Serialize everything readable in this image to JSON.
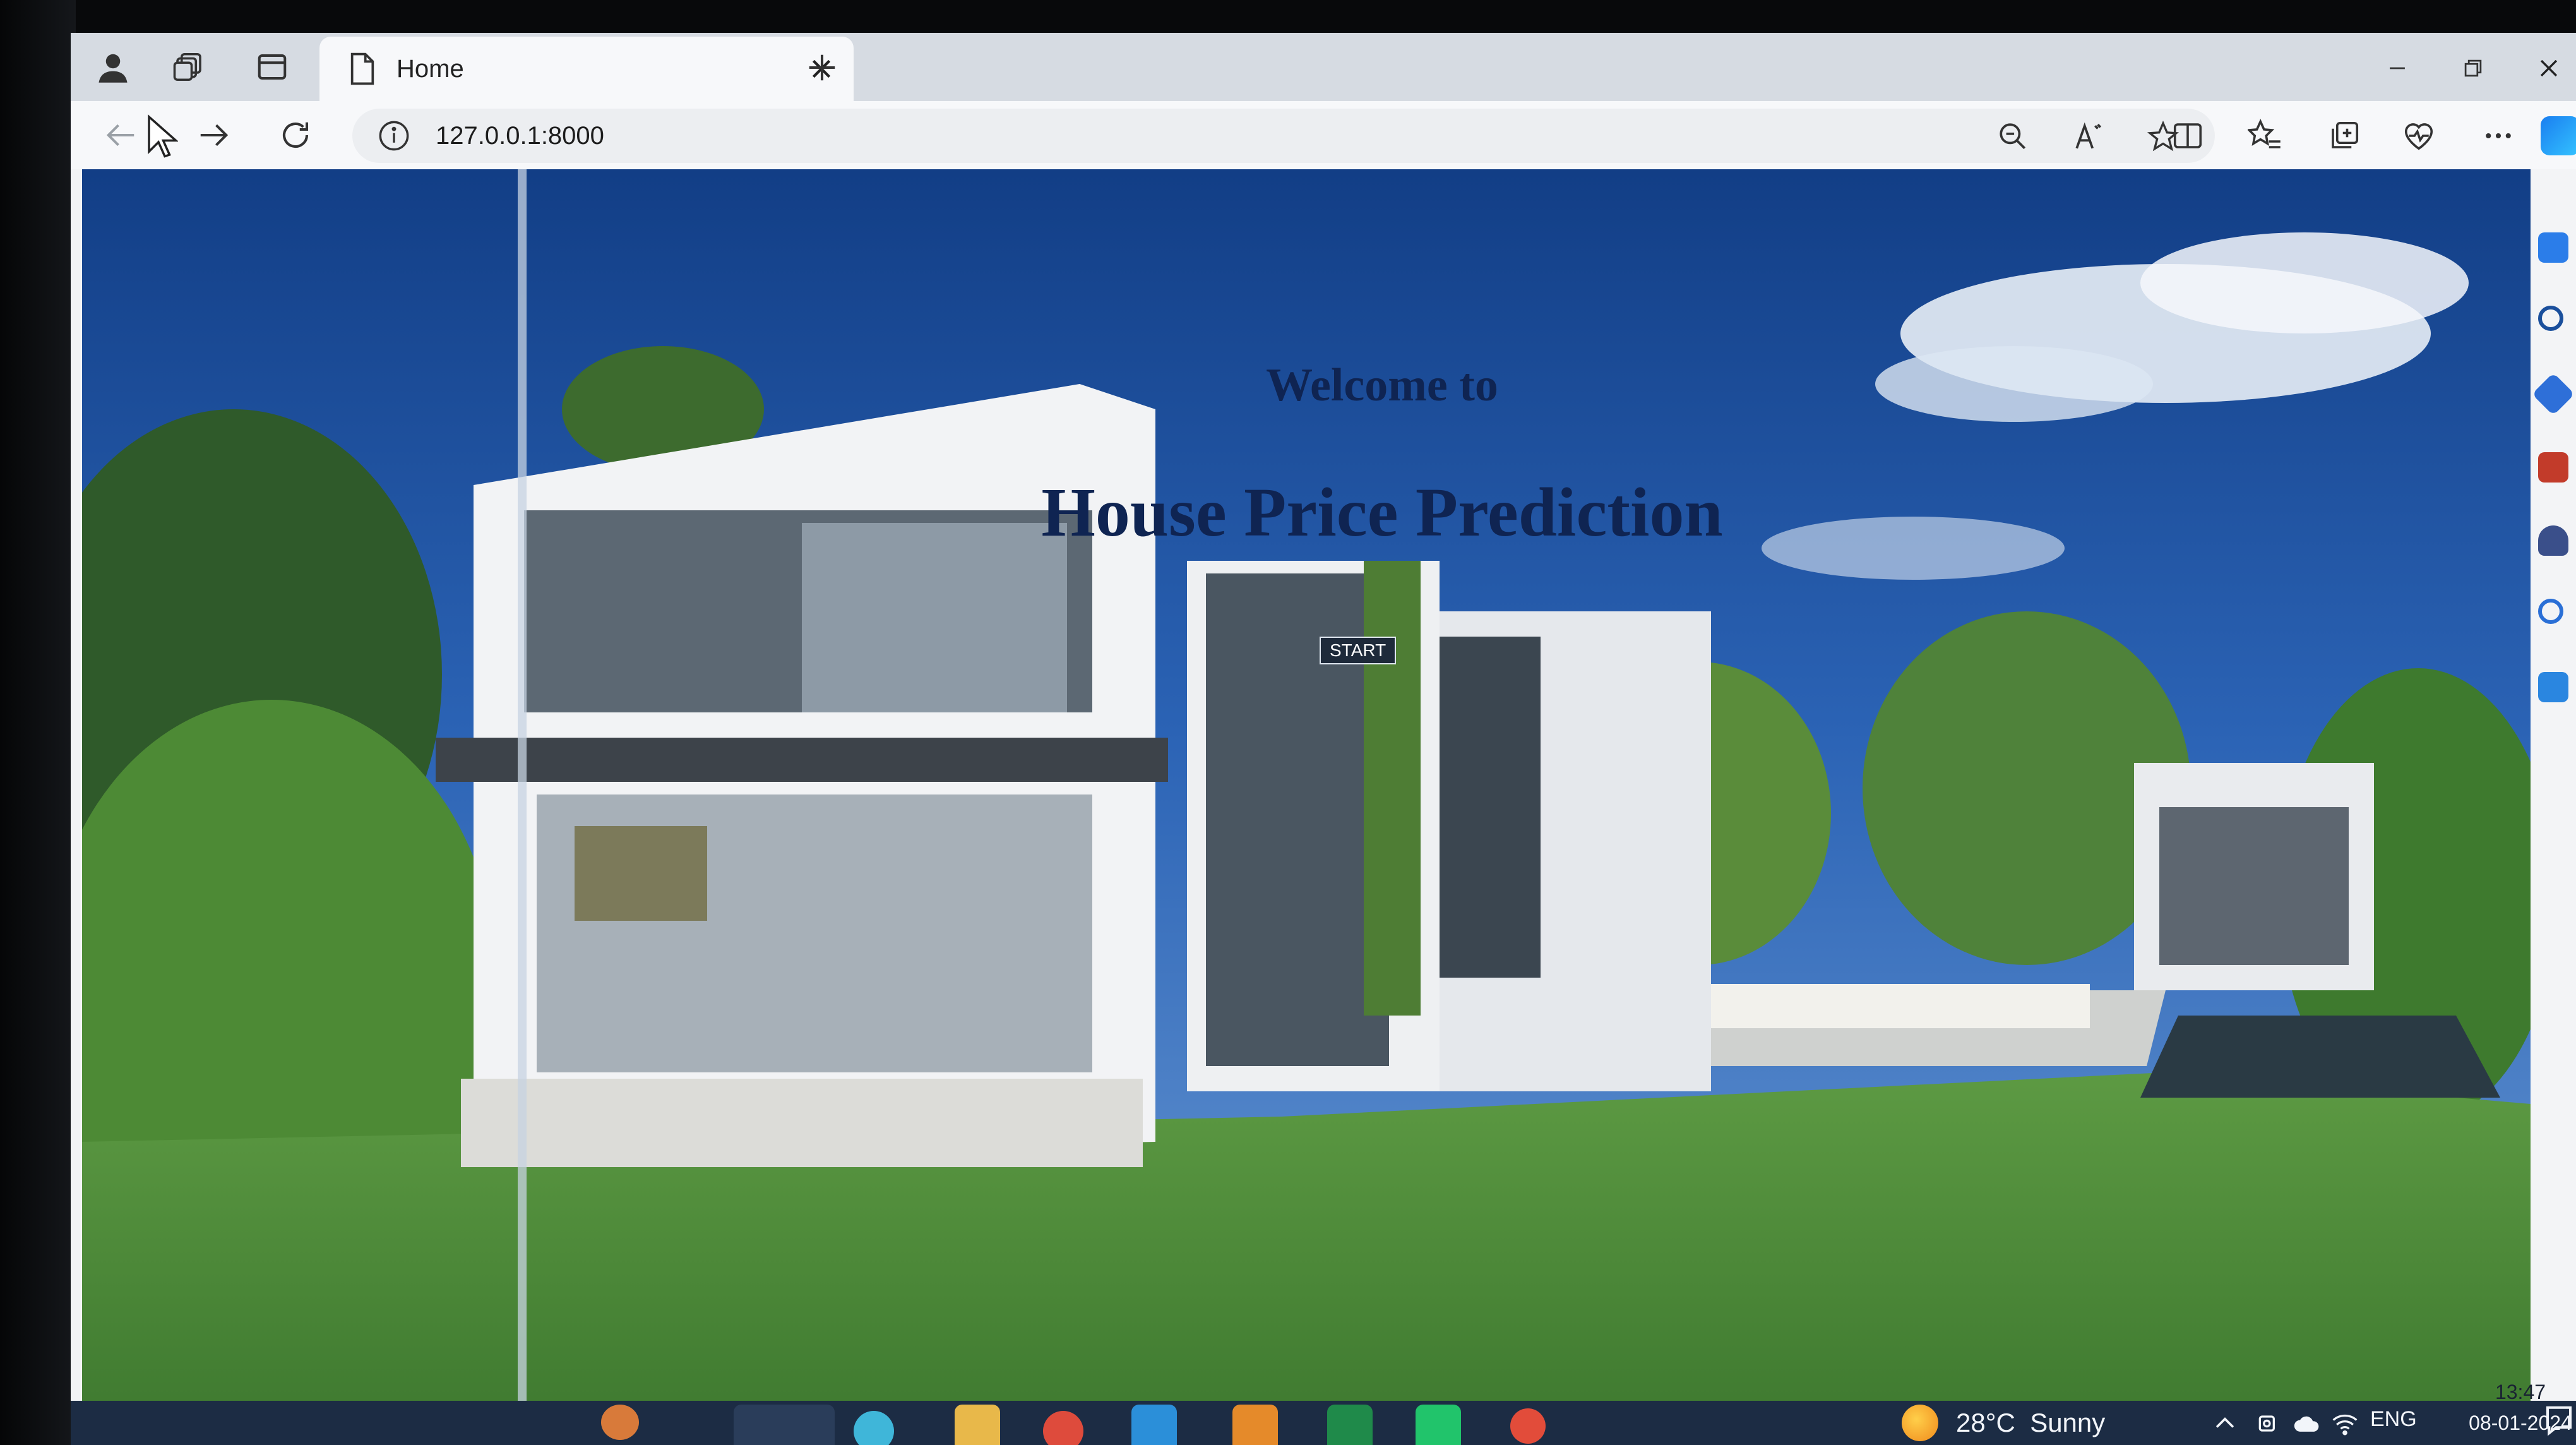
{
  "browser": {
    "tab": {
      "title": "Home"
    },
    "address_bar": {
      "url": "127.0.0.1:8000"
    }
  },
  "page": {
    "welcome_text": "Welcome to",
    "heading": "House Price Prediction",
    "start_button_label": "START"
  },
  "taskbar": {
    "weather": {
      "temperature": "28°C",
      "condition": "Sunny"
    },
    "language": "ENG",
    "clock": {
      "time": "13:47",
      "date": "08-01-2024"
    }
  },
  "colors": {
    "heading": "#0f2452",
    "sky": "#2b63b5",
    "lawn": "#4e8f3a",
    "taskbar": "#1c2c44",
    "tab_strip": "#d6dbe2"
  },
  "icons": [
    "profile-icon",
    "workspaces-icon",
    "tab-actions-icon",
    "page-icon",
    "close-icon",
    "plus-icon",
    "minimize-icon",
    "restore-icon",
    "close-window-icon",
    "back-arrow-icon",
    "forward-arrow-icon",
    "refresh-icon",
    "cursor-icon",
    "info-icon",
    "zoom-out-icon",
    "read-aloud-icon",
    "star-icon",
    "split-screen-icon",
    "favorites-icon",
    "collections-icon",
    "heart-pulse-icon",
    "more-icon",
    "copilot-icon"
  ]
}
